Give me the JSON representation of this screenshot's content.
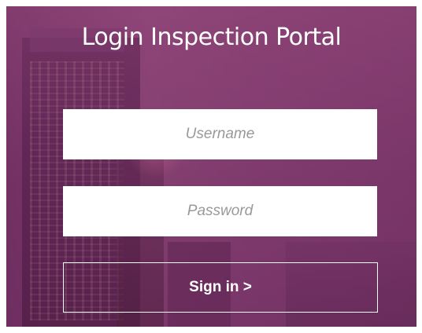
{
  "portal": {
    "title": "Login Inspection Portal"
  },
  "form": {
    "username_placeholder": "Username",
    "password_placeholder": "Password",
    "signin_label": "Sign in >"
  },
  "colors": {
    "overlay": "#7e3d6e",
    "field_bg": "#ffffff",
    "button_border": "#ffffff"
  }
}
